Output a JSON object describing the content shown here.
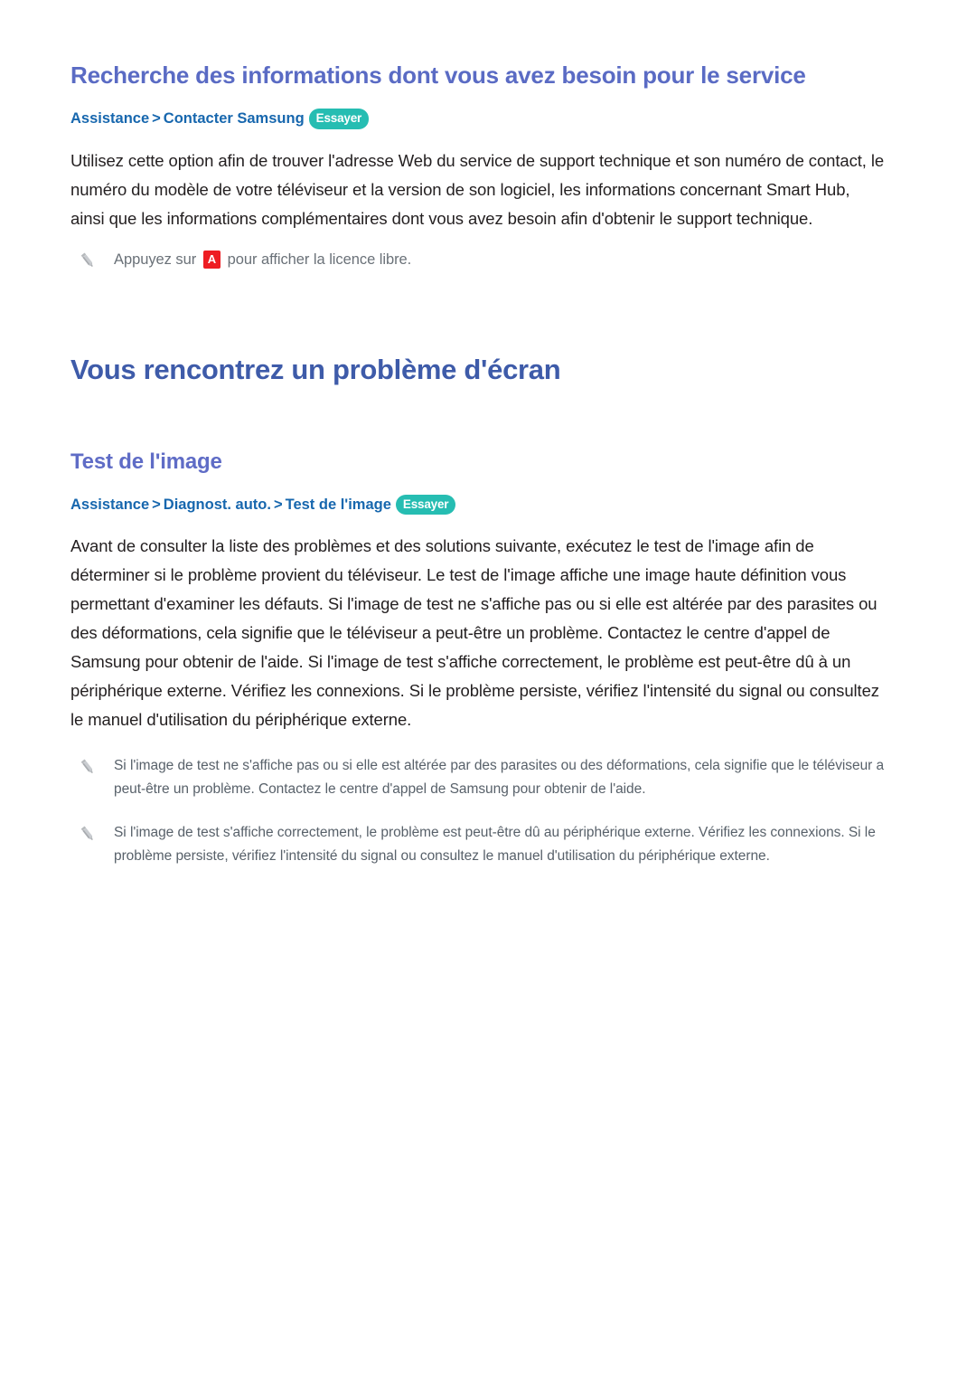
{
  "doc": {
    "section_heading": "Recherche des informations dont vous avez besoin pour le service",
    "breadcrumb_1": {
      "crumb_1": "Assistance",
      "sep_1": ">",
      "crumb_2": "Contacter Samsung",
      "pill": "Essayer"
    },
    "paragraph_1": "Utilisez cette option afin de trouver l'adresse Web du service de support technique et son numéro de contact, le numéro du modèle de votre téléviseur et la version de son logiciel, les informations concernant Smart Hub, ainsi que les informations complémentaires dont vous avez besoin afin d'obtenir le support technique.",
    "note_1": {
      "prefix": "Appuyez sur",
      "key": "A",
      "suffix": "pour afficher la licence libre.",
      "icon": "pencil-icon"
    },
    "chapter_heading": "Vous rencontrez un problème d'écran",
    "subsection_heading": "Test de l'image",
    "breadcrumb_2": {
      "crumb_1": "Assistance",
      "sep_1": ">",
      "crumb_2": "Diagnost. auto.",
      "sep_2": ">",
      "crumb_3": "Test de l'image",
      "pill": "Essayer"
    },
    "paragraph_2": "Avant de consulter la liste des problèmes et des solutions suivante, exécutez le test de l'image afin de déterminer si le problème provient du téléviseur. Le test de l'image affiche une image haute définition vous permettant d'examiner les défauts. Si l'image de test ne s'affiche pas ou si elle est altérée par des parasites ou des déformations, cela signifie que le téléviseur a peut-être un problème. Contactez le centre d'appel de Samsung pour obtenir de l'aide. Si l'image de test s'affiche correctement, le problème est peut-être dû à un périphérique externe. Vérifiez les connexions. Si le problème persiste, vérifiez l'intensité du signal ou consultez le manuel d'utilisation du périphérique externe.",
    "note_2": {
      "text": "Si l'image de test ne s'affiche pas ou si elle est altérée par des parasites ou des déformations, cela signifie que le téléviseur a peut-être un problème. Contactez le centre d'appel de Samsung pour obtenir de l'aide.",
      "icon": "pencil-icon"
    },
    "note_3": {
      "text": "Si l'image de test s'affiche correctement, le problème est peut-être dû au périphérique externe. Vérifiez les connexions. Si le problème persiste, vérifiez l'intensité du signal ou consultez le manuel d'utilisation du périphérique externe.",
      "icon": "pencil-icon"
    }
  },
  "colors": {
    "section_heading": "#5a6bc4",
    "chapter_heading": "#3e5ba9",
    "subsection_heading": "#5f6cc6",
    "breadcrumb": "#1767ae",
    "pill_bg": "#26bdb2",
    "key_badge_bg": "#ee1d23",
    "body_text": "#231f20",
    "note_text": "#58616a",
    "page_bg": "#ffffff"
  }
}
